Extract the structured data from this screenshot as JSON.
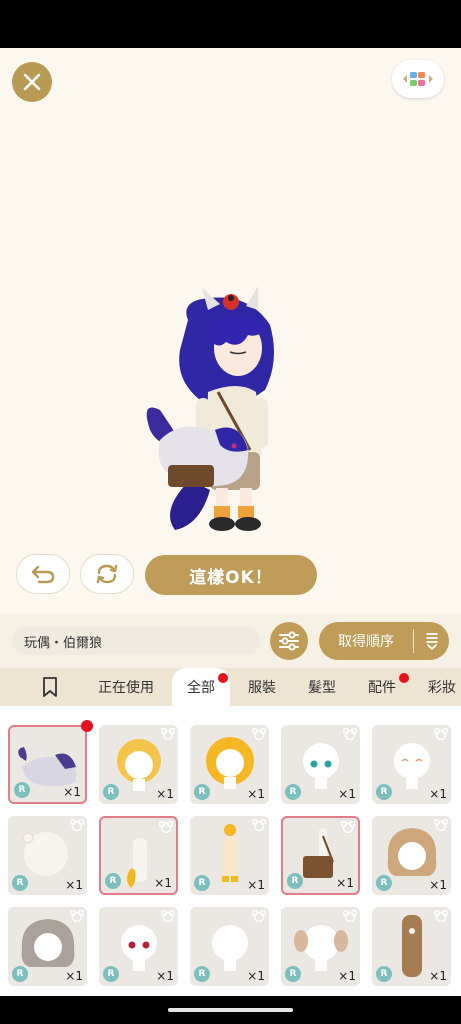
{
  "toolbar": {
    "ok_label": "這樣OK！"
  },
  "item_bar": {
    "item_name": "玩偶・伯爾狼",
    "sort_label": "取得順序"
  },
  "tabs": [
    {
      "label": "正在使用"
    },
    {
      "label": "全部"
    },
    {
      "label": "服裝"
    },
    {
      "label": "髮型"
    },
    {
      "label": "配件"
    },
    {
      "label": "彩妝"
    }
  ],
  "items": [
    {
      "rarity": "R",
      "qty": "×1"
    },
    {
      "rarity": "R",
      "qty": "×1"
    },
    {
      "rarity": "R",
      "qty": "×1"
    },
    {
      "rarity": "R",
      "qty": "×1"
    },
    {
      "rarity": "R",
      "qty": "×1"
    },
    {
      "rarity": "R",
      "qty": "×1"
    },
    {
      "rarity": "R",
      "qty": "×1"
    },
    {
      "rarity": "R",
      "qty": "×1"
    },
    {
      "rarity": "R",
      "qty": "×1"
    },
    {
      "rarity": "R",
      "qty": "×1"
    },
    {
      "rarity": "R",
      "qty": "×1"
    },
    {
      "rarity": "R",
      "qty": "×1"
    },
    {
      "rarity": "R",
      "qty": "×1"
    },
    {
      "rarity": "R",
      "qty": "×1"
    },
    {
      "rarity": "R",
      "qty": "×1"
    }
  ],
  "colors": {
    "accent_gold": "#bf9c58",
    "stage_bg": "#fdf8ef",
    "notification_red": "#e8111b",
    "selected_border": "#e37d88",
    "rarity_badge": "#7bbfbf"
  }
}
